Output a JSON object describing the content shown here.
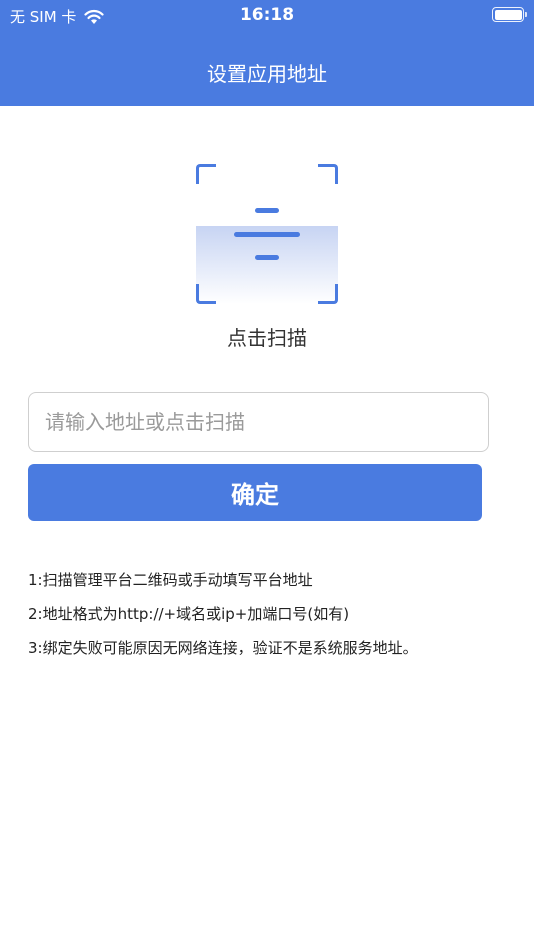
{
  "status_bar": {
    "carrier": "无 SIM 卡",
    "time": "16:18",
    "wifi_icon": "wifi-icon",
    "battery_icon": "battery-icon",
    "battery_level": 1.0
  },
  "header": {
    "title": "设置应用地址",
    "background_color": "#4a7be0"
  },
  "scan": {
    "icon": "qr-scan-icon",
    "label": "点击扫描"
  },
  "address_input": {
    "value": "",
    "placeholder": "请输入地址或点击扫描"
  },
  "confirm_button": {
    "label": "确定",
    "color": "#4a7be0"
  },
  "notes": [
    "1:扫描管理平台二维码或手动填写平台地址",
    "2:地址格式为http://+域名或ip+加端口号(如有)",
    "3:绑定失败可能原因无网络连接，验证不是系统服务地址。"
  ]
}
